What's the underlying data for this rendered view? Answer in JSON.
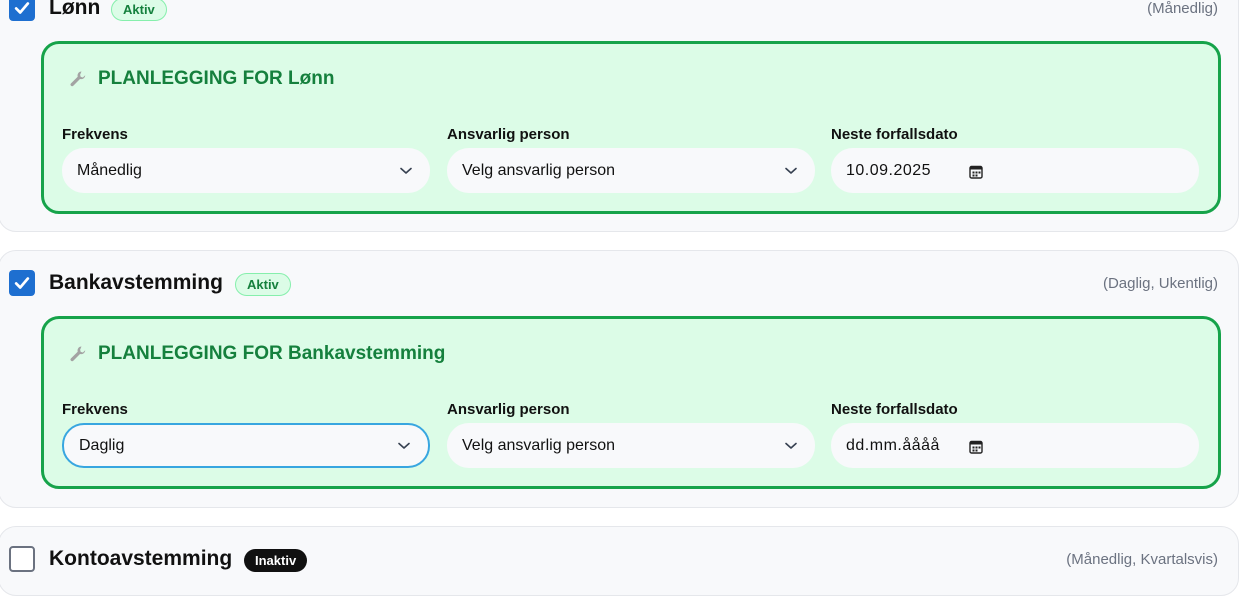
{
  "tasks": [
    {
      "title": "Lønn",
      "checked": true,
      "status": "Aktiv",
      "frequencies": "(Månedlig)",
      "plan": {
        "title": "PLANLEGGING FOR Lønn",
        "frequency_label": "Frekvens",
        "frequency_value": "Månedlig",
        "person_label": "Ansvarlig person",
        "person_value": "Velg ansvarlig person",
        "date_label": "Neste forfallsdato",
        "date_value": "10.09.2025"
      }
    },
    {
      "title": "Bankavstemming",
      "checked": true,
      "status": "Aktiv",
      "frequencies": "(Daglig, Ukentlig)",
      "plan": {
        "title": "PLANLEGGING FOR Bankavstemming",
        "frequency_label": "Frekvens",
        "frequency_value": "Daglig",
        "person_label": "Ansvarlig person",
        "person_value": "Velg ansvarlig person",
        "date_label": "Neste forfallsdato",
        "date_value": "dd.mm.åååå"
      }
    },
    {
      "title": "Kontoavstemming",
      "checked": false,
      "status": "Inaktiv",
      "frequencies": "(Månedlig, Kvartalsvis)"
    }
  ],
  "colors": {
    "accent_blue": "#1e6fd0",
    "active_green": "#15803d",
    "panel_green": "#dcfce7",
    "panel_border": "#16a34a",
    "focus_ring": "#38a6e0"
  },
  "icons": {
    "checkbox_checked": "check-icon",
    "plan": "wrench-icon",
    "select": "chevron-down-icon",
    "date": "calendar-icon"
  }
}
